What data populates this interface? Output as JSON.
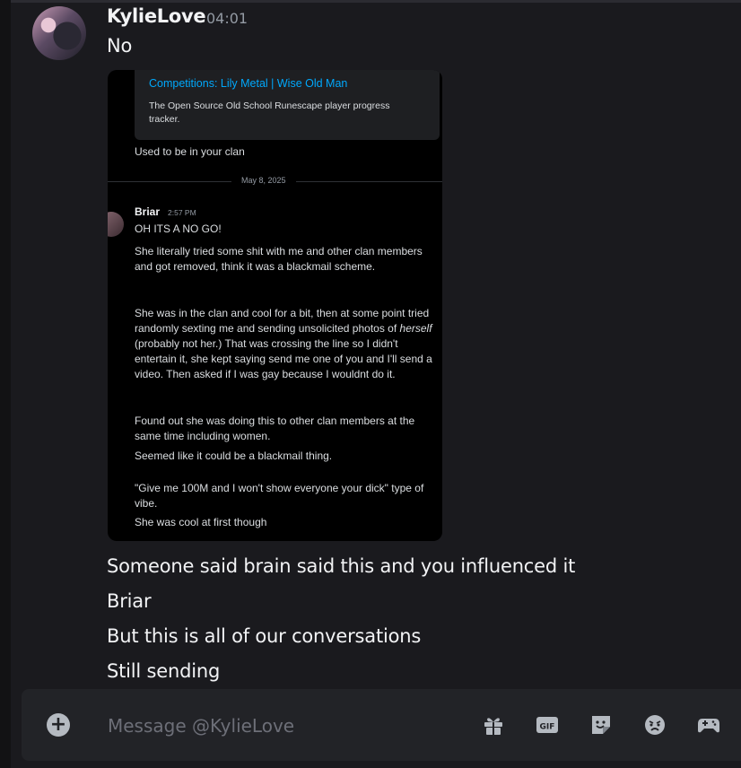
{
  "message": {
    "author": "KylieLove",
    "timestamp": "04:01",
    "first_line": "No",
    "lines": [
      "Someone said brain said this and you influenced it",
      "Briar",
      "But this is all of our conversations",
      "Still sending"
    ]
  },
  "attachment": {
    "embed_title": "Competitions: Lily Metal | Wise Old Man",
    "embed_description": "The Open Source Old School Runescape player progress tracker.",
    "line_before": "Used to be in your clan",
    "date_divider": "May 8, 2025",
    "inner_author": "Briar",
    "inner_time": "2:57 PM",
    "inner_lines": {
      "l1": "OH ITS A NO GO!",
      "l2": "She literally tried some shit with me and other clan members and got removed, think it was a blackmail scheme.",
      "l3_pre": "She was in the clan and cool for a bit, then at some point tried randomly sexting me and sending unsolicited photos of ",
      "l3_em": "herself",
      "l3_post": " (probably not her.) That was crossing the line so I didn't entertain it, she kept saying send me one of you and I'll send a video. Then asked if I was gay because I wouldnt do it.",
      "l4": "Found out she was doing this to other clan members at the same time including women.",
      "l5": "Seemed like it could be a blackmail thing.",
      "l6": "\"Give me 100M and I won't show everyone your dick\" type of vibe.",
      "l7": "She was cool at first though"
    }
  },
  "composer": {
    "placeholder": "Message @KylieLove",
    "icons": [
      "gift-icon",
      "gif-icon",
      "sticker-icon",
      "emoji-icon",
      "activity-icon"
    ]
  },
  "colors": {
    "background": "#1a1a1e",
    "composer": "#222327",
    "link": "#00a8fc"
  }
}
